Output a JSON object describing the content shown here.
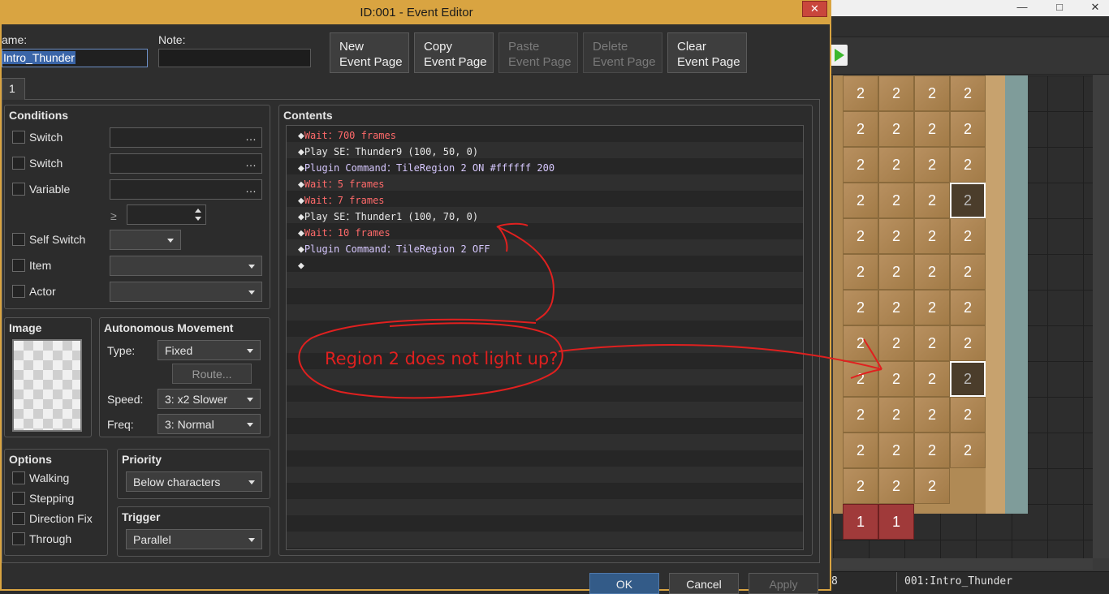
{
  "window": {
    "title": "ID:001 - Event Editor",
    "close_glyph": "✕"
  },
  "name": {
    "label": "ame:",
    "value": "Intro_Thunder"
  },
  "note": {
    "label": "Note:",
    "value": ""
  },
  "top_buttons": [
    {
      "line1": "New",
      "line2": "Event Page",
      "enabled": true
    },
    {
      "line1": "Copy",
      "line2": "Event Page",
      "enabled": true
    },
    {
      "line1": "Paste",
      "line2": "Event Page",
      "enabled": false
    },
    {
      "line1": "Delete",
      "line2": "Event Page",
      "enabled": false
    },
    {
      "line1": "Clear",
      "line2": "Event Page",
      "enabled": true
    }
  ],
  "page_tab": "1",
  "conditions": {
    "title": "Conditions",
    "switch1": "Switch",
    "switch2": "Switch",
    "variable": "Variable",
    "ge_symbol": "≥",
    "self_switch": "Self Switch",
    "item": "Item",
    "actor": "Actor",
    "ellipsis": "…"
  },
  "image": {
    "title": "Image"
  },
  "autonomous": {
    "title": "Autonomous Movement",
    "type_label": "Type:",
    "type_value": "Fixed",
    "route_label": "Route...",
    "speed_label": "Speed:",
    "speed_value": "3: x2 Slower",
    "freq_label": "Freq:",
    "freq_value": "3: Normal"
  },
  "options": {
    "title": "Options",
    "items": [
      "Walking",
      "Stepping",
      "Direction Fix",
      "Through"
    ]
  },
  "priority": {
    "title": "Priority",
    "value": "Below characters"
  },
  "trigger": {
    "title": "Trigger",
    "value": "Parallel"
  },
  "contents": {
    "title": "Contents",
    "commands": [
      {
        "kind": "wait",
        "text": "Wait：700 frames"
      },
      {
        "kind": "play",
        "text": "Play SE：Thunder9 (100, 50, 0)"
      },
      {
        "kind": "plugin",
        "text": "Plugin Command：TileRegion 2 ON #ffffff 200"
      },
      {
        "kind": "wait",
        "text": "Wait：5 frames"
      },
      {
        "kind": "wait",
        "text": "Wait：7 frames"
      },
      {
        "kind": "play",
        "text": "Play SE：Thunder1 (100, 70, 0)"
      },
      {
        "kind": "wait",
        "text": "Wait：10 frames"
      },
      {
        "kind": "plugin",
        "text": "Plugin Command：TileRegion 2 OFF"
      },
      {
        "kind": "empty",
        "text": ""
      }
    ],
    "diamond": "◆"
  },
  "bottom_buttons": {
    "ok": "OK",
    "cancel": "Cancel",
    "apply": "Apply"
  },
  "annotation": {
    "text": "Region 2 does not light up?"
  },
  "map": {
    "region_label_2": "2",
    "region_label_1": "1",
    "window_controls": [
      "—",
      "□",
      "✕"
    ]
  },
  "status": {
    "left": "8",
    "right": "001:Intro_Thunder"
  },
  "colors": {
    "accent": "#d9a441",
    "wait": "#ff6a6a",
    "plugin": "#d7c8ff",
    "annotation": "#e0201f"
  }
}
